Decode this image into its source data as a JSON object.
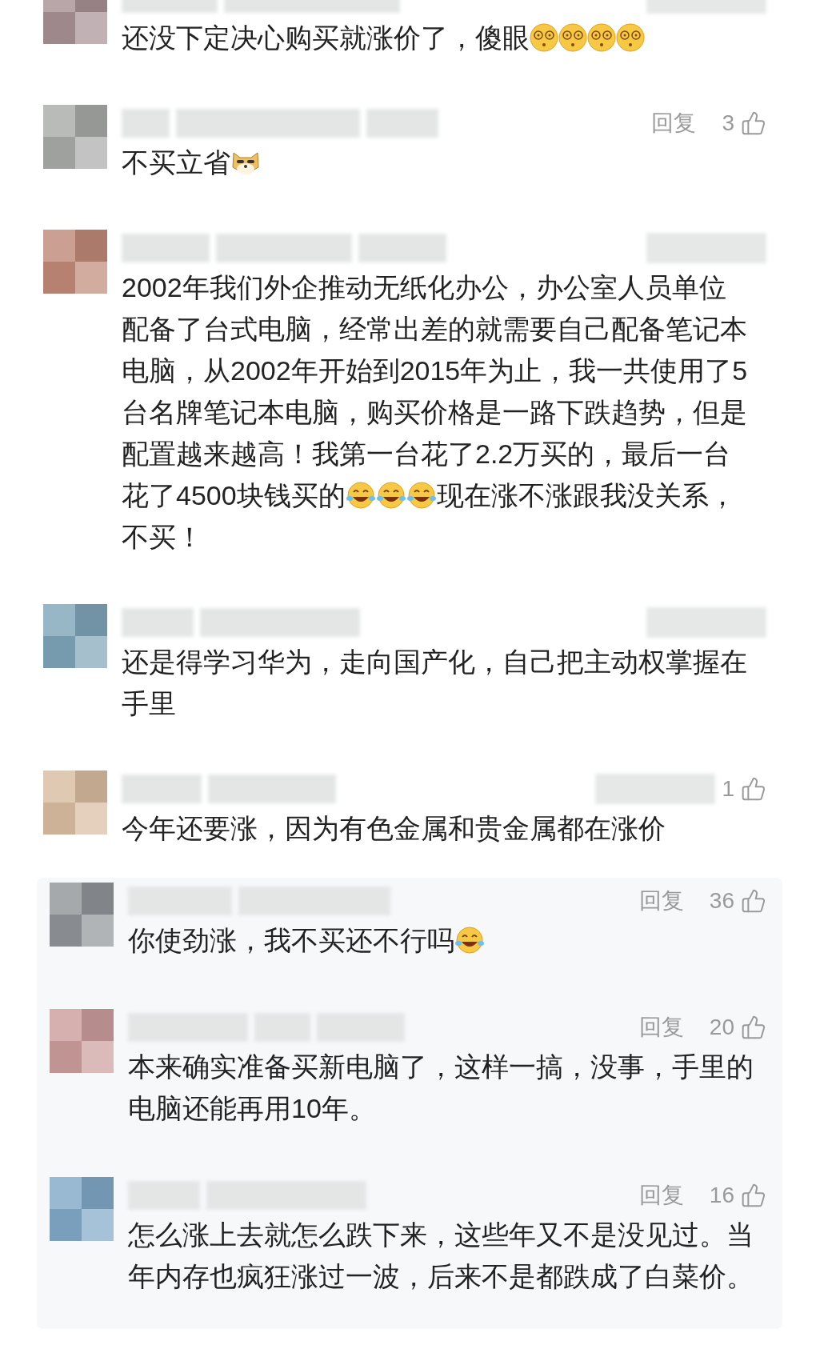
{
  "comments": [
    {
      "color": "#a89094",
      "blurred_meta": true,
      "lines": [
        [
          {
            "kind": "text",
            "text": "还没下定决心购买就涨价了，傻眼"
          },
          {
            "kind": "dizzy"
          },
          {
            "kind": "dizzy"
          },
          {
            "kind": "dizzy"
          },
          {
            "kind": "dizzy"
          }
        ]
      ]
    },
    {
      "color": "#a8aaa8",
      "blurred_meta": false,
      "reply": "回复",
      "likes": "3",
      "lines": [
        [
          {
            "kind": "text",
            "text": "不买立省"
          },
          {
            "kind": "doge"
          }
        ]
      ]
    },
    {
      "color": "#c08878",
      "blurred_meta": true,
      "lines": [
        [
          {
            "kind": "text",
            "text": "2002年我们外企推动无纸化办公，办公室人员单位"
          }
        ],
        [
          {
            "kind": "text",
            "text": "配备了台式电脑，经常出差的就需要自己配备笔记本"
          }
        ],
        [
          {
            "kind": "text",
            "text": "电脑，从2002年开始到2015年为止，我一共使用了5"
          }
        ],
        [
          {
            "kind": "text",
            "text": "台名牌笔记本电脑，购买价格是一路下跌趋势，但是"
          }
        ],
        [
          {
            "kind": "text",
            "text": "配置越来越高！我第一台花了2.2万买的，最后一台"
          }
        ],
        [
          {
            "kind": "text",
            "text": "花了4500块钱买的"
          },
          {
            "kind": "laugh"
          },
          {
            "kind": "laugh"
          },
          {
            "kind": "laugh"
          },
          {
            "kind": "text",
            "text": "现在涨不涨跟我没关系，"
          }
        ],
        [
          {
            "kind": "text",
            "text": "不买！"
          }
        ]
      ]
    },
    {
      "color": "#7ea4b8",
      "blurred_meta": true,
      "lines": [
        [
          {
            "kind": "text",
            "text": "还是得学习华为，走向国产化，自己把主动权掌握在"
          }
        ],
        [
          {
            "kind": "text",
            "text": "手里"
          }
        ]
      ]
    },
    {
      "color": "#d8bca0",
      "blurred_meta": true,
      "likes": "1",
      "lines": [
        [
          {
            "kind": "text",
            "text": "今年还要涨，因为有色金属和贵金属都在涨价"
          }
        ]
      ]
    }
  ],
  "replies": [
    {
      "color": "#909498",
      "blurred_meta": false,
      "reply": "回复",
      "likes": "36",
      "lines": [
        [
          {
            "kind": "text",
            "text": "你使劲涨，我不买还不行吗"
          },
          {
            "kind": "laugh"
          }
        ]
      ]
    },
    {
      "color": "#cc9c9c",
      "blurred_meta": false,
      "reply": "回复",
      "likes": "20",
      "lines": [
        [
          {
            "kind": "text",
            "text": "本来确实准备买新电脑了，这样一搞，没事，手里的"
          }
        ],
        [
          {
            "kind": "text",
            "text": "电脑还能再用10年。"
          }
        ]
      ]
    },
    {
      "color": "#80a8c8",
      "blurred_meta": false,
      "reply": "回复",
      "likes": "16",
      "lines": [
        [
          {
            "kind": "text",
            "text": "怎么涨上去就怎么跌下来，这些年又不是没见过。当"
          }
        ],
        [
          {
            "kind": "text",
            "text": "年内存也疯狂涨过一波，后来不是都跌成了白菜价。"
          }
        ]
      ]
    }
  ]
}
